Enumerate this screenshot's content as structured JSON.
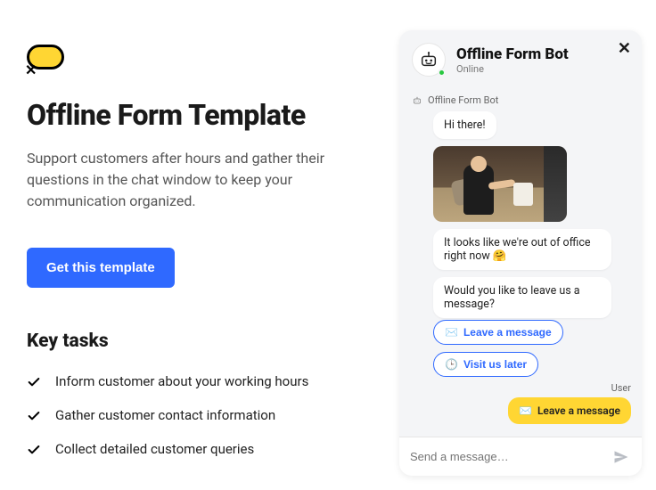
{
  "page": {
    "title": "Offline Form Template",
    "subtitle": "Support customers after hours and gather their questions in the chat window to keep your communication organized.",
    "cta_label": "Get this template",
    "tasks_heading": "Key tasks",
    "tasks": [
      "Inform customer about your working hours",
      "Gather customer contact information",
      "Collect detailed customer queries"
    ]
  },
  "widget": {
    "bot_name": "Offline Form Bot",
    "status_text": "Online",
    "thread_bot_label": "Offline Form Bot",
    "messages": {
      "hi": "Hi there!",
      "out_of_office": "It looks like we're out of office right now 🤗",
      "leave_msg_prompt": "Would you like to leave us a message?"
    },
    "quick_replies": {
      "leave_message": "Leave a message",
      "visit_later": "Visit us later"
    },
    "user_label": "User",
    "user_choice": "Leave a message",
    "composer_placeholder": "Send a message…"
  },
  "icons": {
    "envelope": "✉️",
    "clock": "🕒"
  }
}
